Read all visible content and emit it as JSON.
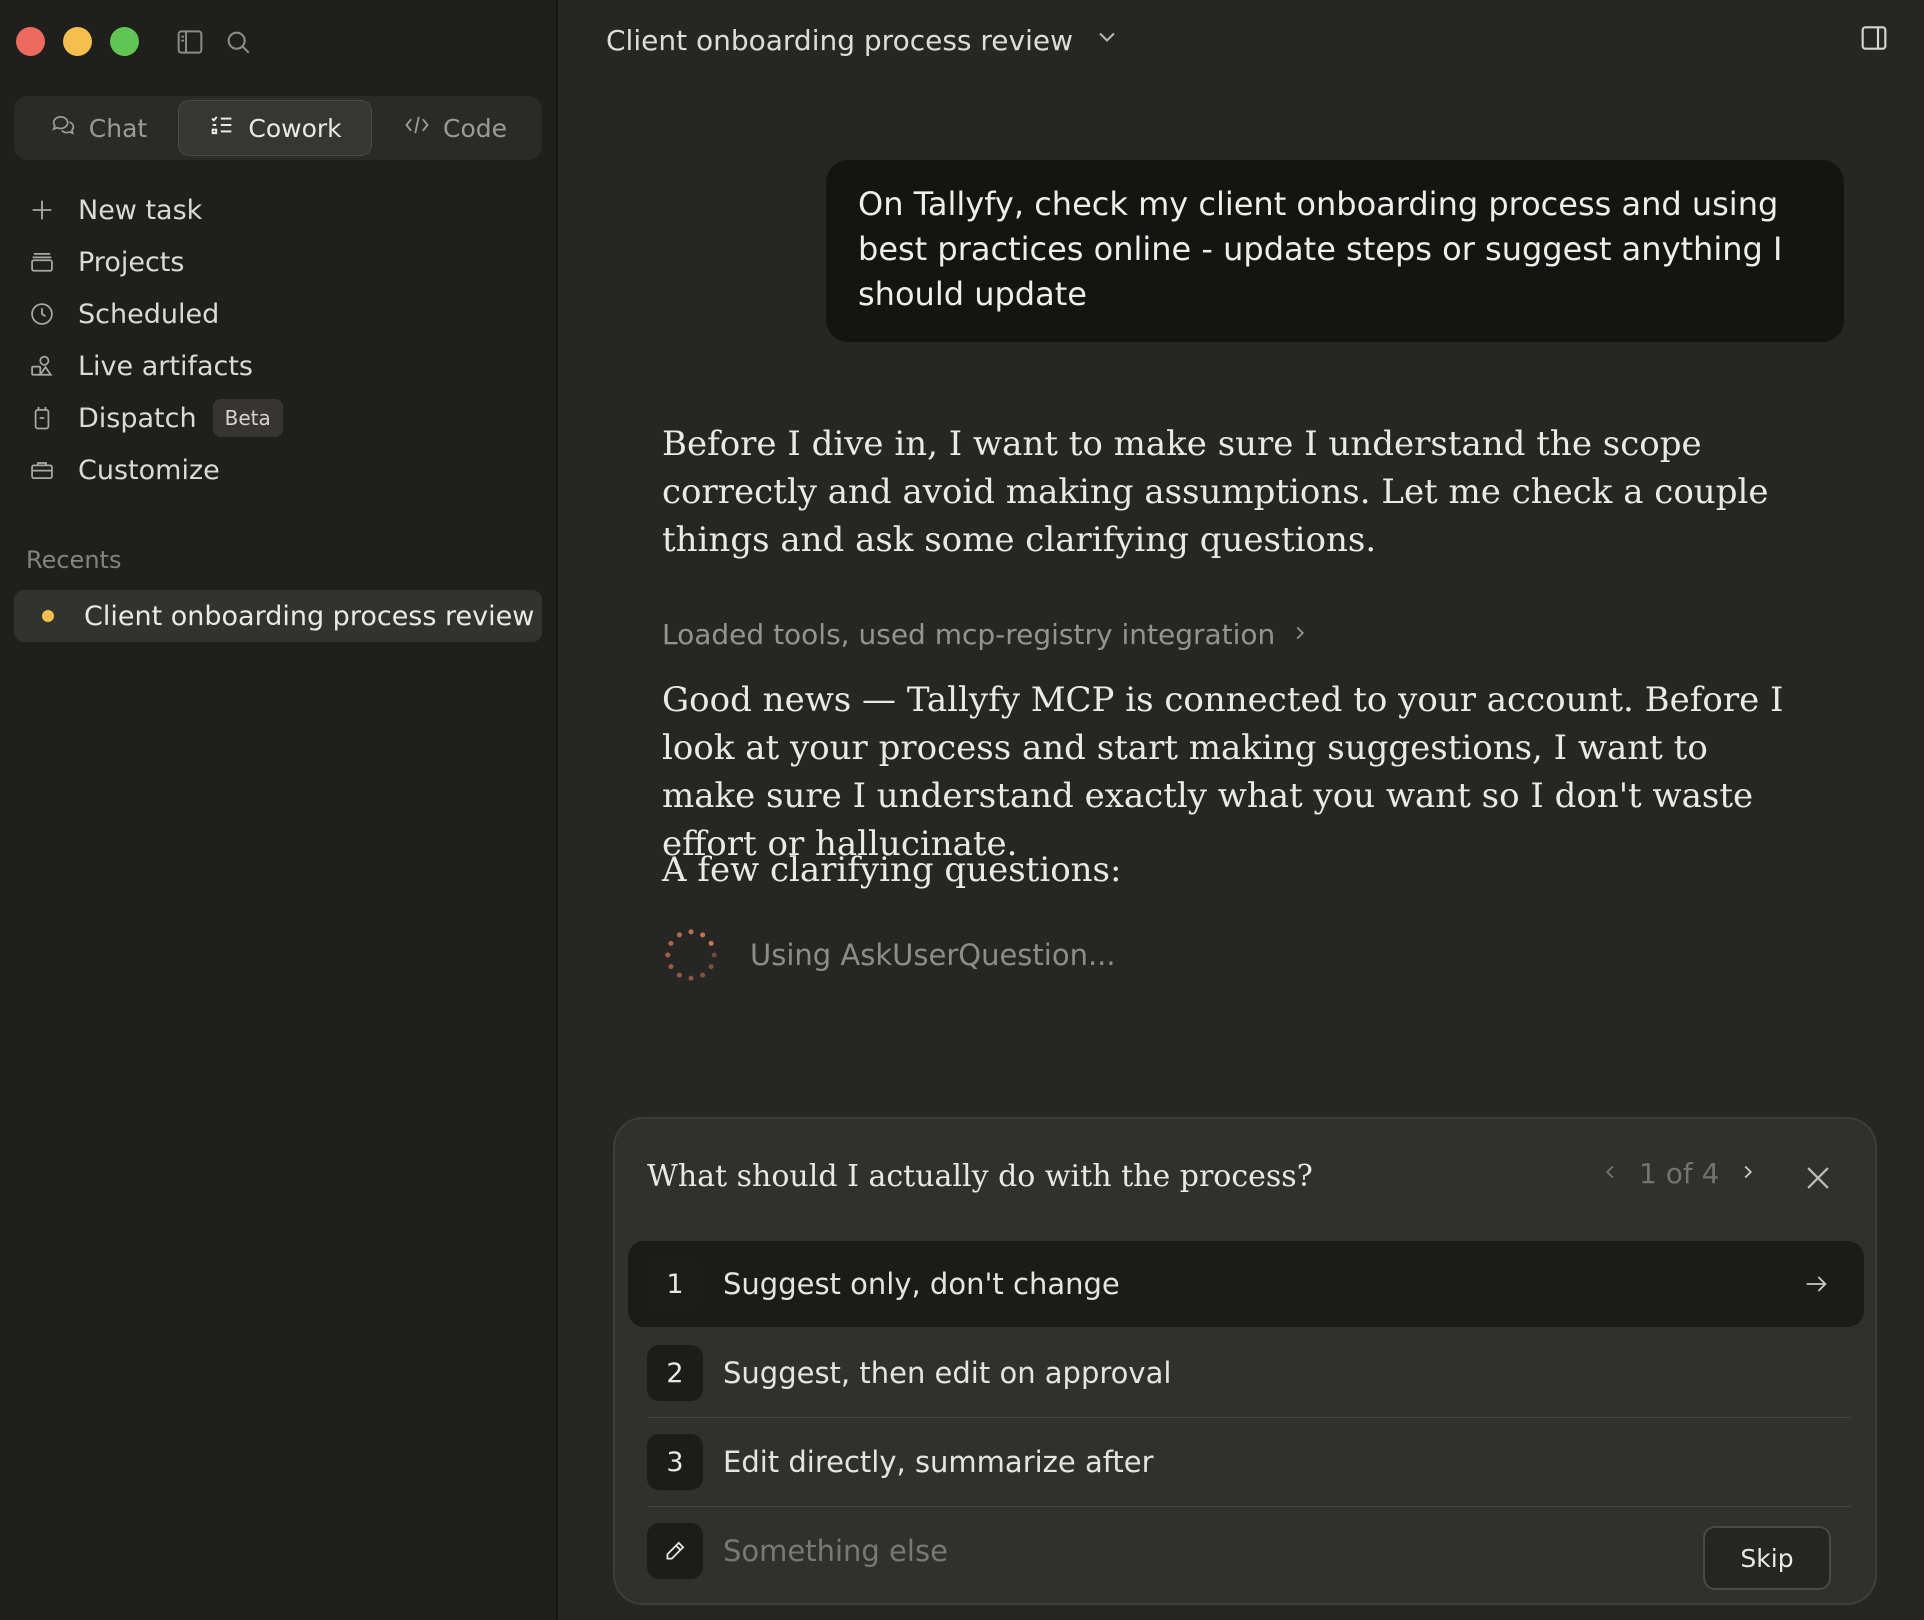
{
  "window": {
    "title": "Client onboarding process review"
  },
  "sidebar": {
    "modes": [
      {
        "label": "Chat",
        "icon": "chat-bubbles-icon",
        "active": false
      },
      {
        "label": "Cowork",
        "icon": "checklist-icon",
        "active": true
      },
      {
        "label": "Code",
        "icon": "code-brackets-icon",
        "active": false
      }
    ],
    "nav": [
      {
        "label": "New task",
        "icon": "plus-icon"
      },
      {
        "label": "Projects",
        "icon": "folder-stack-icon"
      },
      {
        "label": "Scheduled",
        "icon": "clock-icon"
      },
      {
        "label": "Live artifacts",
        "icon": "shapes-icon"
      },
      {
        "label": "Dispatch",
        "icon": "device-icon",
        "badge": "Beta"
      },
      {
        "label": "Customize",
        "icon": "briefcase-icon"
      }
    ],
    "recents_heading": "Recents",
    "recents": [
      {
        "label": "Client onboarding process review",
        "status_color": "#f0c24b"
      }
    ]
  },
  "conversation": {
    "user_message": "On Tallyfy, check my client onboarding process and using best practices online - update steps or suggest anything I should update",
    "assistant_intro": "Before I dive in, I want to make sure I understand the scope correctly and avoid making assumptions. Let me check a couple things and ask some clarifying questions.",
    "tool_summary": "Loaded tools, used mcp-registry integration",
    "assistant_followup": "Good news — Tallyfy MCP is connected to your account. Before I look at your process and start making suggestions, I want to make sure I understand exactly what you want so I don't waste effort or hallucinate.",
    "questions_lead": "A few clarifying questions:",
    "tool_status": "Using AskUserQuestion..."
  },
  "question_card": {
    "question": "What should I actually do with the process?",
    "pager": "1 of 4",
    "options": [
      {
        "number": "1",
        "label": "Suggest only, don't change"
      },
      {
        "number": "2",
        "label": "Suggest, then edit on approval"
      },
      {
        "number": "3",
        "label": "Edit directly, summarize after"
      }
    ],
    "other_placeholder": "Something else",
    "skip_label": "Skip"
  },
  "colors": {
    "accent_spinner": "#d97757",
    "recent_dot": "#f0c24b"
  }
}
